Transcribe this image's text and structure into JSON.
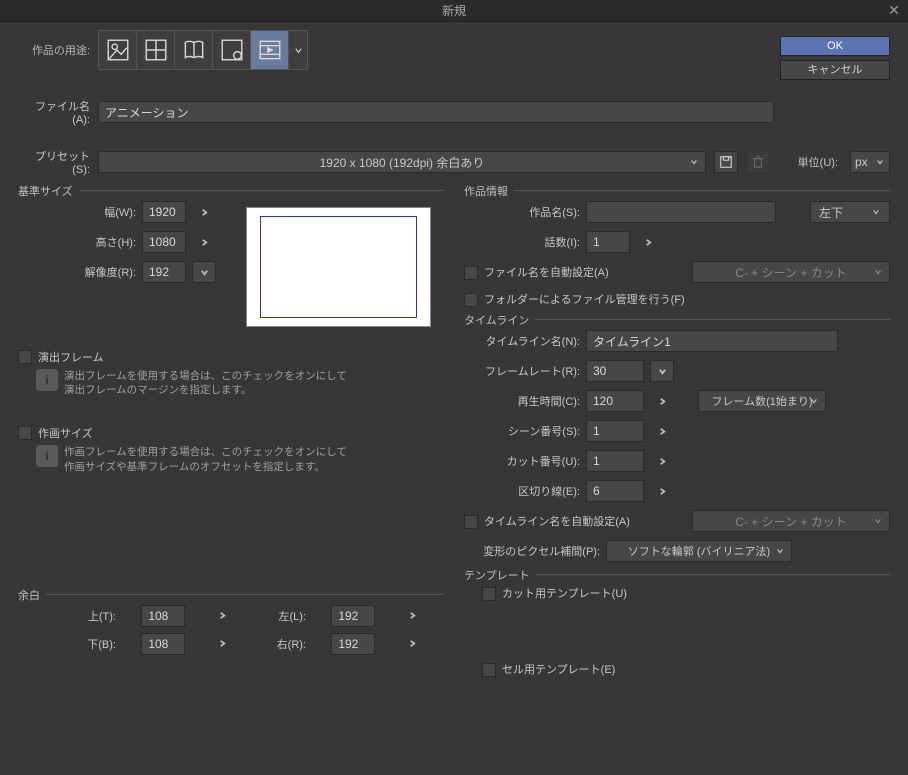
{
  "title": "新規",
  "buttons": {
    "ok": "OK",
    "cancel": "キャンセル"
  },
  "labels": {
    "purpose": "作品の用途:",
    "filename": "ファイル名(A):",
    "preset": "プリセット(S):",
    "unit": "単位(U):"
  },
  "filename": "アニメーション",
  "preset": "1920 x 1080 (192dpi) 余白あり",
  "unit": "px",
  "base": {
    "title": "基準サイズ",
    "width_lbl": "幅(W):",
    "width": "1920",
    "height_lbl": "高さ(H):",
    "height": "1080",
    "dpi_lbl": "解像度(R):",
    "dpi": "192"
  },
  "direction": {
    "cb": "演出フレーム",
    "info": "演出フレームを使用する場合は、このチェックをオンにして\n演出フレームのマージンを指定します。"
  },
  "drawing": {
    "cb": "作画サイズ",
    "info": "作画フレームを使用する場合は、このチェックをオンにして\n作画サイズや基準フレームのオフセットを指定します。"
  },
  "margin": {
    "title": "余白",
    "top_lbl": "上(T):",
    "top": "108",
    "bottom_lbl": "下(B):",
    "bottom": "108",
    "left_lbl": "左(L):",
    "left": "192",
    "right_lbl": "右(R):",
    "right": "192"
  },
  "work": {
    "title": "作品情報",
    "name_lbl": "作品名(S):",
    "name": "",
    "pos": "左下",
    "ep_lbl": "話数(I):",
    "ep": "1",
    "auto_fn": "ファイル名を自動設定(A)",
    "auto_fn_fmt": "C- + シーン + カット",
    "folder": "フォルダーによるファイル管理を行う(F)"
  },
  "timeline": {
    "title": "タイムライン",
    "name_lbl": "タイムライン名(N):",
    "name": "タイムライン1",
    "fps_lbl": "フレームレート(R):",
    "fps": "30",
    "dur_lbl": "再生時間(C):",
    "dur": "120",
    "frame_mode": "フレーム数(1始まり)",
    "scene_lbl": "シーン番号(S):",
    "scene": "1",
    "cut_lbl": "カット番号(U):",
    "cut": "1",
    "div_lbl": "区切り線(E):",
    "div": "6",
    "auto_tl": "タイムライン名を自動設定(A)",
    "auto_tl_fmt": "C- + シーン + カット",
    "interp_lbl": "変形のピクセル補間(P):",
    "interp": "ソフトな輪郭 (バイリニア法)"
  },
  "template": {
    "title": "テンプレート",
    "cut": "カット用テンプレート(U)",
    "cel": "セル用テンプレート(E)"
  }
}
